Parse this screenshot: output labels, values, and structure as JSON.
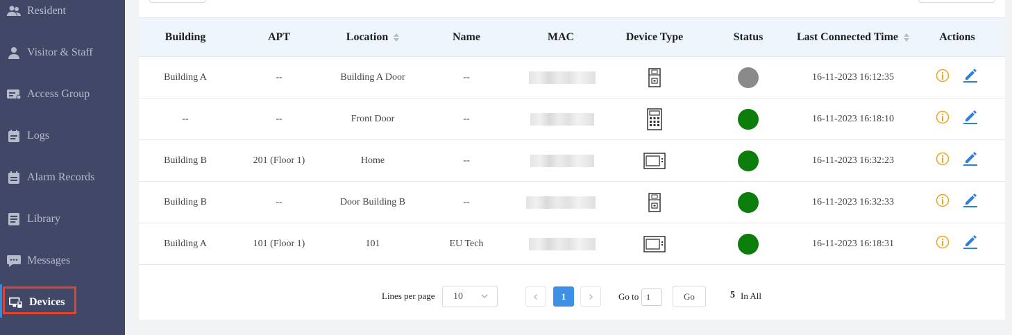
{
  "sidebar": {
    "items": [
      {
        "label": "Resident",
        "icon": "residents-icon",
        "active": false
      },
      {
        "label": "Visitor & Staff",
        "icon": "visitor-icon",
        "active": false
      },
      {
        "label": "Access Group",
        "icon": "access-card-icon",
        "active": false
      },
      {
        "label": "Logs",
        "icon": "logs-icon",
        "active": false
      },
      {
        "label": "Alarm Records",
        "icon": "alarm-record-icon",
        "active": false
      },
      {
        "label": "Library",
        "icon": "library-icon",
        "active": false
      },
      {
        "label": "Messages",
        "icon": "messages-icon",
        "active": false
      },
      {
        "label": "Devices",
        "icon": "devices-icon",
        "active": true
      }
    ]
  },
  "table": {
    "headers": {
      "building": "Building",
      "apt": "APT",
      "location": "Location",
      "name": "Name",
      "mac": "MAC",
      "device_type": "Device Type",
      "status": "Status",
      "last_connected": "Last Connected Time",
      "actions": "Actions"
    },
    "rows": [
      {
        "building": "Building A",
        "apt": "--",
        "location": "Building A Door",
        "name": "--",
        "device_icon": "door-phone-icon",
        "status": "offline",
        "last_connected": "16-11-2023 16:12:35"
      },
      {
        "building": "--",
        "apt": "--",
        "location": "Front Door",
        "name": "--",
        "device_icon": "keypad-door-phone-icon",
        "status": "online",
        "last_connected": "16-11-2023 16:18:10"
      },
      {
        "building": "Building B",
        "apt": "201 (Floor 1)",
        "location": "Home",
        "name": "--",
        "device_icon": "indoor-monitor-icon",
        "status": "online",
        "last_connected": "16-11-2023 16:32:23"
      },
      {
        "building": "Building B",
        "apt": "--",
        "location": "Door Building B",
        "name": "--",
        "device_icon": "door-phone-icon",
        "status": "online",
        "last_connected": "16-11-2023 16:32:33"
      },
      {
        "building": "Building A",
        "apt": "101 (Floor 1)",
        "location": "101",
        "name": "EU Tech",
        "device_icon": "indoor-monitor-icon",
        "status": "online",
        "last_connected": "16-11-2023 16:18:31"
      }
    ]
  },
  "pagination": {
    "lines_per_page_label": "Lines per page",
    "lines_per_page_value": "10",
    "current_page": "1",
    "goto_label": "Go to",
    "goto_value": "1",
    "go_button": "Go",
    "total": "5",
    "total_label": "In All"
  },
  "colors": {
    "sidebar_bg": "#414766",
    "online": "#0a7d0a",
    "offline": "#8a8a8a",
    "info_icon": "#f0a41d",
    "edit_icon": "#2d7fd8",
    "highlight": "#e8412c"
  }
}
